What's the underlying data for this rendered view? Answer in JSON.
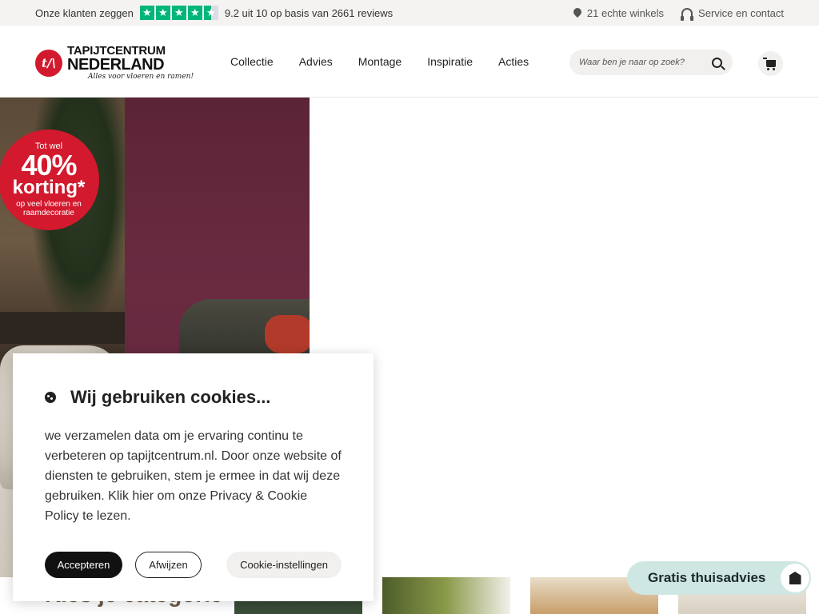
{
  "topbar": {
    "customers_say": "Onze klanten zeggen",
    "rating_text": "9.2 uit 10 op basis van 2661 reviews",
    "stores": "21 echte winkels",
    "service": "Service en contact"
  },
  "brand": {
    "logo_mark": "t/\\",
    "name_line1": "TAPIJTCENTRUM",
    "name_line2": "NEDERLAND",
    "tagline": "Alles voor vloeren en ramen!"
  },
  "nav": {
    "items": [
      "Collectie",
      "Advies",
      "Montage",
      "Inspiratie",
      "Acties"
    ]
  },
  "search": {
    "placeholder": "Waar ben je naar op zoek?"
  },
  "hero": {
    "badge_line1": "Tot wel",
    "badge_line2": "40%",
    "badge_line3": "korting*",
    "badge_line4": "op veel vloeren en raamdecoratie"
  },
  "cookie": {
    "title": "Wij gebruiken cookies...",
    "text": "we verzamelen data om je ervaring continu te verbeteren op tapijtcentrum.nl. Door onze website of diensten te gebruiken, stem je ermee in dat wij deze gebruiken. Klik hier om onze Privacy & Cookie Policy te lezen.",
    "accept": "Accepteren",
    "decline": "Afwijzen",
    "settings": "Cookie-instellingen"
  },
  "category": {
    "heading": "Kies je categorie"
  },
  "advice": {
    "label": "Gratis thuisadvies"
  },
  "colors": {
    "brand_red": "#d2192d",
    "trustpilot_green": "#00b67a",
    "advice_bg": "#cfe7e3"
  }
}
